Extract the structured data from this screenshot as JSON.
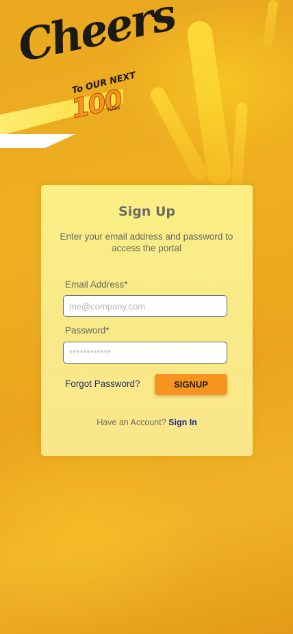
{
  "logo": {
    "brand": "Cheers",
    "tagline": "To OUR NEXT",
    "number": "100",
    "years": "YEARS"
  },
  "signup": {
    "title": "Sign Up",
    "subtitle": "Enter your email address and password to access the portal",
    "email_label": "Email Address*",
    "email_placeholder": "me@company.com",
    "email_value": "",
    "password_label": "Password*",
    "password_placeholder": "************",
    "password_value": "",
    "forgot_label": "Forgot Password?",
    "submit_label": "SIGNUP",
    "account_prompt": "Have an Account?",
    "signin_label": "Sign In"
  },
  "colors": {
    "background": "#eba91f",
    "card": "#fbef84",
    "button": "#f7931f",
    "link": "#1e2a8a"
  }
}
